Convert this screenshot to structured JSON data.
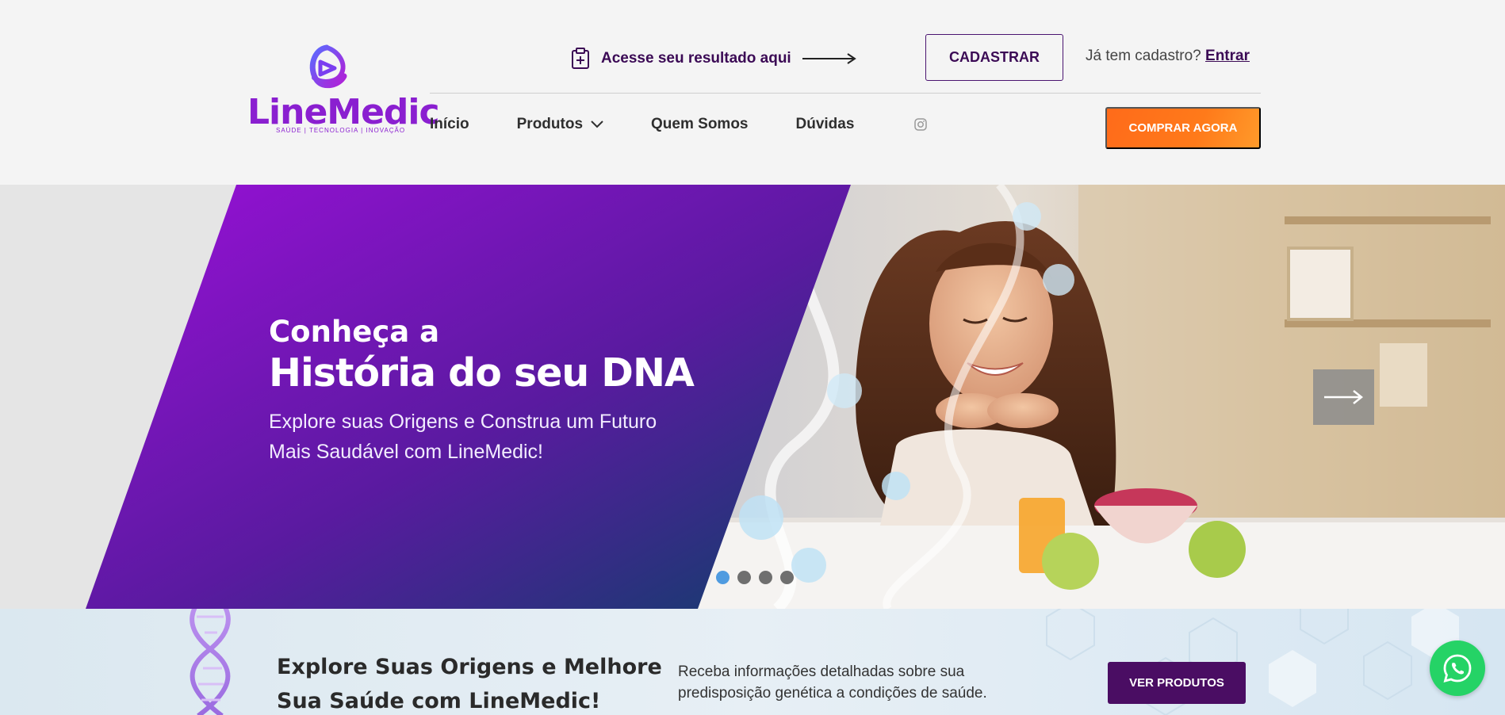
{
  "brand": {
    "name": "LineMedic",
    "tagline": "SAÚDE | TECNOLOGIA | INOVAÇÃO",
    "color": "#8a1fd0"
  },
  "topbar": {
    "result_link": "Acesse seu resultado aqui",
    "register_button": "CADASTRAR",
    "login_prompt": "Já tem cadastro?",
    "login_link": "Entrar"
  },
  "nav": {
    "items": [
      {
        "label": "Início"
      },
      {
        "label": "Produtos",
        "has_dropdown": true
      },
      {
        "label": "Quem Somos"
      },
      {
        "label": "Dúvidas"
      }
    ],
    "social_icon": "instagram-icon",
    "cta": "COMPRAR AGORA",
    "cta_color": "#ff7a1a"
  },
  "hero": {
    "line1": "Conheça a",
    "line2": "História do seu DNA",
    "subtitle": "Explore suas Origens e Construa um Futuro Mais Saudável com LineMedic!",
    "slides_total": 4,
    "active_slide": 1,
    "next_icon": "arrow-right-icon"
  },
  "strip": {
    "title": "Explore Suas Origens e Melhore Sua Saúde com LineMedic!",
    "text": "Receba informações detalhadas sobre sua predisposição genética a condições de saúde.",
    "button": "VER PRODUTOS",
    "button_color": "#4a0d63"
  },
  "floating": {
    "whatsapp_icon": "whatsapp-icon",
    "whatsapp_color": "#25d366"
  }
}
